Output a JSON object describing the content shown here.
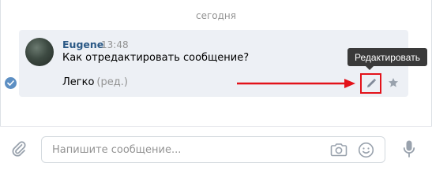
{
  "date_separator": "сегодня",
  "message": {
    "author": "Eugene",
    "time": "13:48",
    "text": "Как отредактировать сообщение?",
    "reply": "Легко",
    "edited_label": "(ред.)"
  },
  "tooltip": "Редактировать",
  "composer": {
    "placeholder": "Напишите сообщение..."
  },
  "icons": {
    "read": "check-icon",
    "edit": "pencil-icon",
    "favorite": "star-icon",
    "attach": "paperclip-icon",
    "camera": "camera-icon",
    "emoji": "smile-icon",
    "voice": "microphone-icon"
  },
  "colors": {
    "author": "#2a5885",
    "highlight": "#e3121a",
    "message_bg": "#edf0f5",
    "icon": "#99a2ad"
  }
}
